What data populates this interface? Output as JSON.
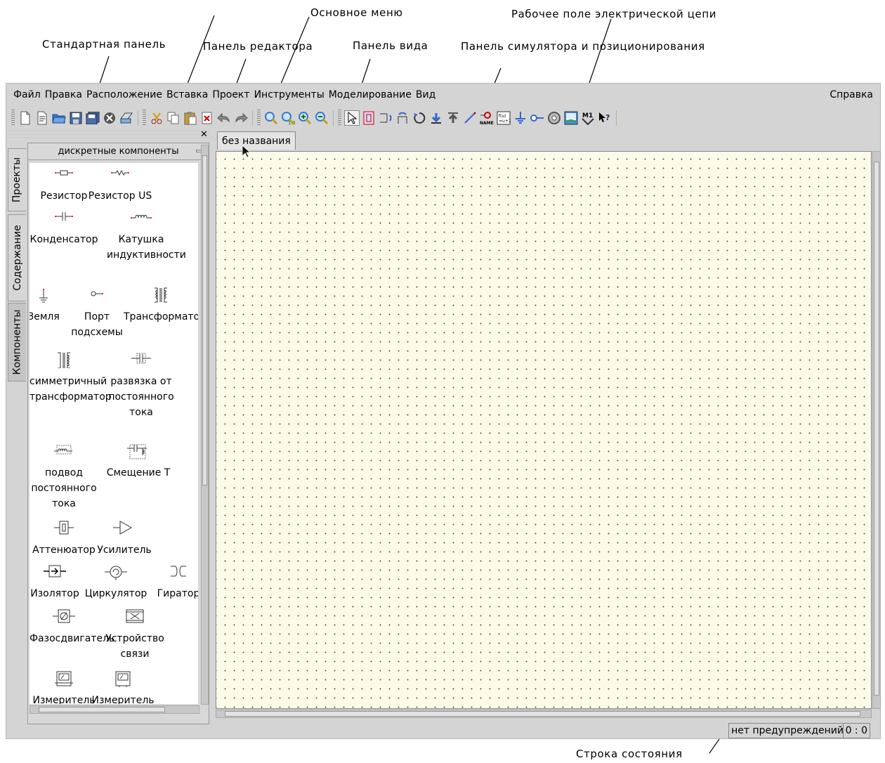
{
  "annotations": {
    "main_menu": "Основное меню",
    "workspace": "Рабочее поле электрической цепи",
    "standard_panel": "Стандартная панель",
    "editor_panel": "Панель редактора",
    "view_panel": "Панель вида",
    "simulator_panel": "Панель симулятора и позиционирования",
    "status_line": "Строка состояния"
  },
  "menu": {
    "items": [
      "Файл",
      "Правка",
      "Расположение",
      "Вставка",
      "Проект",
      "Инструменты",
      "Моделирование",
      "Вид"
    ],
    "help": "Справка"
  },
  "toolbar": {
    "standard_icons": [
      "new-file-icon",
      "new-text-icon",
      "open-folder-icon",
      "save-icon",
      "save-all-icon",
      "close-icon",
      "print-icon"
    ],
    "editor_icons": [
      "cut-icon",
      "copy-icon",
      "paste-icon",
      "delete-icon",
      "undo-icon",
      "redo-icon"
    ],
    "view_icons": [
      "zoom-fit-icon",
      "zoom-1-1-icon",
      "zoom-in-icon",
      "zoom-out-icon"
    ],
    "sim_icons": [
      "select-arrow-icon",
      "edit-activate-icon",
      "mirror-x-icon",
      "mirror-y-icon",
      "rotate-icon",
      "enter-subcircuit-icon",
      "exit-subcircuit-icon",
      "wire-icon",
      "label-name-icon",
      "equation-icon",
      "ground-icon",
      "port-icon",
      "simulate-icon",
      "view-data-icon",
      "marker-icon",
      "whats-this-icon"
    ]
  },
  "sidebar": {
    "tabs": [
      "Проекты",
      "Содержание",
      "Компоненты"
    ],
    "active_tab": "Компоненты",
    "category": "дискретные компоненты",
    "components": [
      {
        "label": "Резистор",
        "icon": "resistor-icon"
      },
      {
        "label": "Резистор US",
        "icon": "resistor-us-icon"
      },
      {
        "label": "Конденсатор",
        "icon": "capacitor-icon"
      },
      {
        "label": "Катушка индуктивности",
        "icon": "inductor-icon"
      },
      {
        "label": "Земля",
        "icon": "ground-icon"
      },
      {
        "label": "Порт подсхемы",
        "icon": "subcircuit-port-icon"
      },
      {
        "label": "Трансформатор",
        "icon": "transformer-icon"
      },
      {
        "label": "симметричный трансформатор",
        "icon": "symmetric-transformer-icon"
      },
      {
        "label": "развязка от постоянного тока",
        "icon": "dc-block-icon"
      },
      {
        "label": "подвод постоянного тока",
        "icon": "dc-feed-icon"
      },
      {
        "label": "Смещение Т",
        "icon": "bias-t-icon"
      },
      {
        "label": "Аттенюатор",
        "icon": "attenuator-icon"
      },
      {
        "label": "Усилитель",
        "icon": "amplifier-icon"
      },
      {
        "label": "Изолятор",
        "icon": "isolator-icon"
      },
      {
        "label": "Циркулятор",
        "icon": "circulator-icon"
      },
      {
        "label": "Гиратор",
        "icon": "gyrator-icon"
      },
      {
        "label": "Фазосдвигатель",
        "icon": "phase-shifter-icon"
      },
      {
        "label": "Устройство связи",
        "icon": "coupler-icon"
      },
      {
        "label": "Измеритель",
        "icon": "current-probe-icon"
      },
      {
        "label": "Измеритель",
        "icon": "voltage-probe-icon"
      }
    ]
  },
  "document": {
    "tab_title": "без названия"
  },
  "status": {
    "warnings": "нет предупреждений",
    "position": "0 : 0"
  }
}
